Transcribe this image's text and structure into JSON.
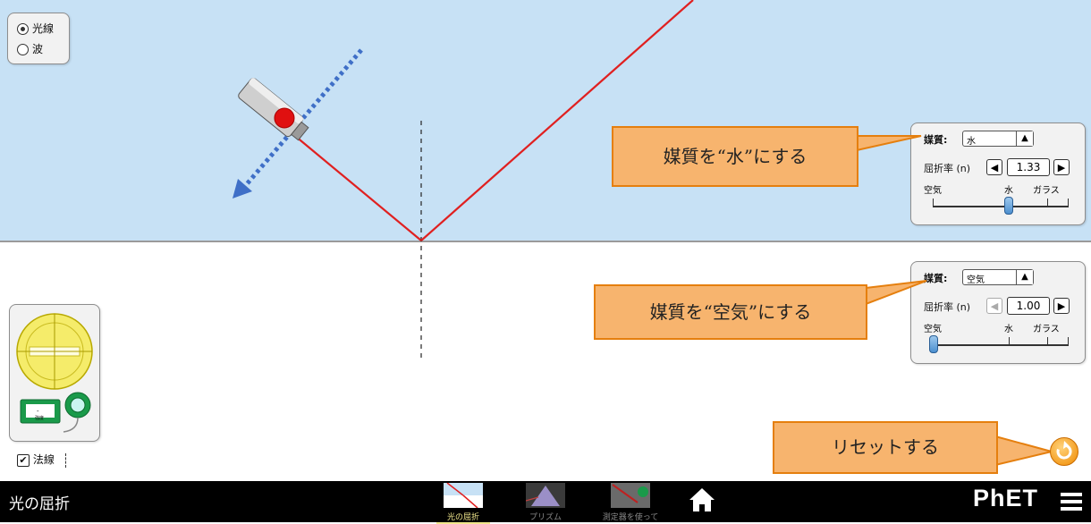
{
  "view_mode": {
    "options": [
      {
        "label": "光線",
        "selected": true
      },
      {
        "label": "波",
        "selected": false
      }
    ]
  },
  "top_medium": {
    "medium_label": "媒質:",
    "medium_value": "水",
    "index_label": "屈折率 (n)",
    "index_value": "1.33",
    "scale_labels": {
      "air": "空気",
      "water": "水",
      "glass": "ガラス"
    },
    "slider_fraction": 0.55
  },
  "bottom_medium": {
    "medium_label": "媒質:",
    "medium_value": "空気",
    "index_label": "屈折率 (n)",
    "index_value": "1.00",
    "scale_labels": {
      "air": "空気",
      "water": "水",
      "glass": "ガラス"
    },
    "slider_fraction": 0.0
  },
  "annotations": {
    "top_callout": "媒質を“水”にする",
    "bottom_callout": "媒質を“空気”にする",
    "reset_callout": "リセットする"
  },
  "toolbox": {
    "normal_label": "法線",
    "normal_checked": true,
    "intensity_meter_label": "強度",
    "intensity_meter_value": "-"
  },
  "navbar": {
    "title": "光の屈折",
    "screens": [
      {
        "label": "光の屈折",
        "active": true
      },
      {
        "label": "プリズム",
        "active": false
      },
      {
        "label": "測定器を使って",
        "active": false
      }
    ],
    "brand": "PhET"
  },
  "colors": {
    "upper_medium": "#c7e1f5",
    "ray": "#e02020",
    "callout_fill": "#f7b46e",
    "callout_border": "#e57f0e",
    "arrow": "#3f6fc7",
    "nav_active": "#f0e68c"
  }
}
